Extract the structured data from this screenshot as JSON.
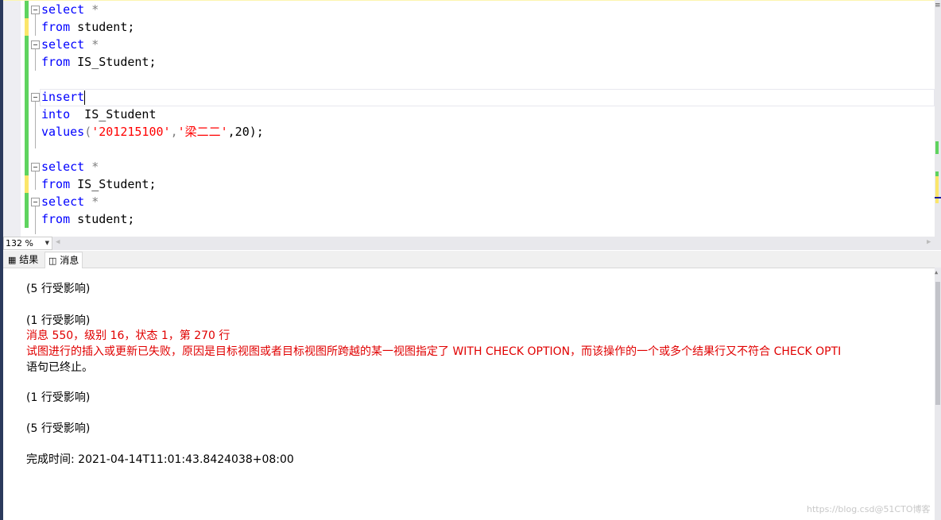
{
  "editor": {
    "lines": [
      {
        "kw": "select",
        "rest": " *",
        "type": "select"
      },
      {
        "kw": "from",
        "rest": " student;",
        "type": "from"
      },
      {
        "kw": "select",
        "rest": " *",
        "type": "select"
      },
      {
        "kw": "from",
        "rest": " IS_Student;",
        "type": "from"
      },
      {
        "kw": "",
        "rest": "",
        "type": "blank"
      },
      {
        "kw": "insert",
        "rest": "",
        "type": "insert"
      },
      {
        "kw": "into",
        "rest": "  IS_Student",
        "type": "into"
      },
      {
        "kw": "values",
        "rest": "",
        "type": "values"
      },
      {
        "kw": "",
        "rest": "",
        "type": "blank"
      },
      {
        "kw": "select",
        "rest": " *",
        "type": "select"
      },
      {
        "kw": "from",
        "rest": " IS_Student;",
        "type": "from"
      },
      {
        "kw": "select",
        "rest": " *",
        "type": "select"
      },
      {
        "kw": "from",
        "rest": " student;",
        "type": "from"
      }
    ],
    "values_line": {
      "open": "(",
      "str1": "'201215100'",
      "comma1": ",",
      "str2": "'梁二二'",
      "tail": ",20);"
    }
  },
  "zoom": {
    "value": "132 %"
  },
  "tabs": [
    {
      "label": "结果",
      "icon": "grid-icon"
    },
    {
      "label": "消息",
      "icon": "messages-icon",
      "active": true
    }
  ],
  "messages": [
    {
      "text": "(5 行受影响)",
      "color": "black"
    },
    {
      "text": "(1 行受影响)",
      "color": "black"
    },
    {
      "text": "消息 550，级别 16，状态 1，第 270 行",
      "color": "red"
    },
    {
      "text": "试图进行的插入或更新已失败，原因是目标视图或者目标视图所跨越的某一视图指定了 WITH CHECK OPTION，而该操作的一个或多个结果行又不符合 CHECK OPTI",
      "color": "red"
    },
    {
      "text": "语句已终止。",
      "color": "black"
    },
    {
      "text": "(1 行受影响)",
      "color": "black"
    },
    {
      "text": "(5 行受影响)",
      "color": "black"
    },
    {
      "text": "完成时间: 2021-04-14T11:01:43.8424038+08:00",
      "color": "black"
    }
  ],
  "watermark": "https://blog.csd@51CTO博客",
  "colors": {
    "keyword": "#0000ff",
    "string": "#ff0000",
    "error": "#e00000",
    "changed_saved": "#5fd35f",
    "changed_unsaved": "#fbe66a"
  }
}
